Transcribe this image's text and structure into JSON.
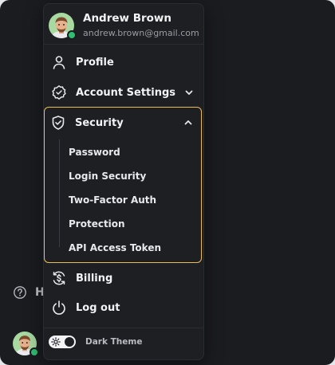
{
  "user": {
    "name": "Andrew Brown",
    "email": "andrew.brown@gmail.com",
    "status": "online"
  },
  "menu": {
    "items": [
      {
        "label": "Profile",
        "icon": "user-icon"
      },
      {
        "label": "Account Settings",
        "icon": "gear-check-icon",
        "chevron": "down"
      },
      {
        "label": "Security",
        "icon": "shield-check-icon",
        "chevron": "up",
        "selected": true
      },
      {
        "label": "Billing",
        "icon": "dollar-refresh-icon"
      },
      {
        "label": "Log out",
        "icon": "power-icon"
      }
    ],
    "security_sub": [
      "Password",
      "Login Security",
      "Two-Factor Auth",
      "Protection",
      "API Access Token"
    ]
  },
  "theme": {
    "label": "Dark Theme",
    "enabled": true
  },
  "background": {
    "help_text": "H"
  },
  "colors": {
    "background": "#1b1c20",
    "menu": "#1e1f23",
    "highlight_border": "#e8be5a",
    "online": "#2fbf71",
    "text": "#f2f3f5",
    "muted": "#9a9ca3"
  }
}
